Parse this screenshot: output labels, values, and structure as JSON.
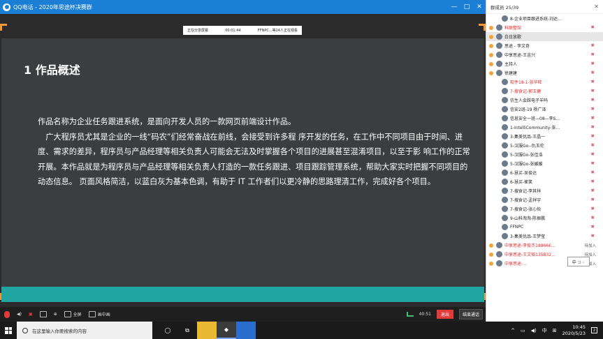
{
  "window": {
    "title": "QQ电话 - 2020年思途杯决赛群",
    "controls": [
      "—",
      "□",
      "✕"
    ]
  },
  "share_status": {
    "label": "正在分享屏幕",
    "timer": "00:01:44",
    "viewers": "FFNPC...等24人正在观看"
  },
  "slide": {
    "title": "1 作品概述",
    "paragraphs": [
      "作品名称为企业任务跟进系统，是面向开发人员的一款网页前端设计作品。",
      "广大程序员尤其是企业的一线“码农”们经常奋战在前线，会接受到许多程 序开发的任务，在工作中不同项目由于时间、进度、需求的差异，程序员与产品经理等相关负责人可能会无法及时掌握各个项目的进展甚至混淆项目，以至于影 响工作的正常开展。本作品就是为程序员与产品经理等相关负责人打造的一款任务跟进、项目跟踪管理系统，帮助大家实时把握不同项目的动态信息。 页面风格简洁，以蓝白灰为基本色调，有助于 IT 工作者们以更冷静的思路理清工作，完成好各个项目。"
    ]
  },
  "toolbar": {
    "fullscreen_label": "全屏",
    "pip_label": "画中画",
    "net_time": "40:51",
    "exit_label": "退出",
    "end_label": "结束通话"
  },
  "panel": {
    "header": "群成员 25/39",
    "members": [
      {
        "name": "8-企业项目跟进系统-刘达...",
        "leader": false,
        "muted": false,
        "status": "",
        "red": false,
        "sel": false
      },
      {
        "name": "科联整馆",
        "leader": true,
        "muted": true,
        "status": "",
        "red": true,
        "sel": false
      },
      {
        "name": "白日放歌",
        "leader": true,
        "muted": false,
        "status": "",
        "red": false,
        "sel": true
      },
      {
        "name": "思途 - 李文奇",
        "leader": true,
        "muted": true,
        "status": "",
        "red": false,
        "sel": false
      },
      {
        "name": "中享思途-王吉兴",
        "leader": true,
        "muted": true,
        "status": "",
        "red": false,
        "sel": false
      },
      {
        "name": "主持人",
        "leader": true,
        "muted": true,
        "status": "",
        "red": false,
        "sel": false
      },
      {
        "name": "徐建建",
        "leader": true,
        "muted": true,
        "status": "",
        "red": false,
        "sel": false
      },
      {
        "name": "软件18-1-张华旺",
        "leader": false,
        "muted": true,
        "status": "",
        "red": true,
        "sel": false
      },
      {
        "name": "7-搜食记-郭玉健",
        "leader": false,
        "muted": true,
        "status": "",
        "red": true,
        "sel": false
      },
      {
        "name": "仿生人会踩电子羊吗",
        "leader": false,
        "muted": true,
        "status": "",
        "red": false,
        "sel": false
      },
      {
        "name": "信安2班-19 杨广泽",
        "leader": false,
        "muted": true,
        "status": "",
        "red": false,
        "sel": false
      },
      {
        "name": "信息安全一班—08—李S...",
        "leader": false,
        "muted": true,
        "status": "",
        "red": false,
        "sel": false
      },
      {
        "name": "1-IntelliCommunity-张...",
        "leader": false,
        "muted": true,
        "status": "",
        "red": false,
        "sel": false
      },
      {
        "name": "3-集美优品-王晶一",
        "leader": false,
        "muted": true,
        "status": "",
        "red": false,
        "sel": false
      },
      {
        "name": "5-汉服Go--仇玉伦",
        "leader": false,
        "muted": true,
        "status": "",
        "red": false,
        "sel": false
      },
      {
        "name": "5-汉服Go-张佳浩",
        "leader": false,
        "muted": true,
        "status": "",
        "red": false,
        "sel": false
      },
      {
        "name": "5-汉服Go-张媛媛",
        "leader": false,
        "muted": true,
        "status": "",
        "red": false,
        "sel": false
      },
      {
        "name": "6-慧买-吴俊达",
        "leader": false,
        "muted": true,
        "status": "",
        "red": false,
        "sel": false
      },
      {
        "name": "6-慧买-崔笑",
        "leader": false,
        "muted": true,
        "status": "",
        "red": false,
        "sel": false
      },
      {
        "name": "7-搜食记-李其祥",
        "leader": false,
        "muted": true,
        "status": "",
        "red": false,
        "sel": false
      },
      {
        "name": "7-搜食记-孟祥宇",
        "leader": false,
        "muted": true,
        "status": "",
        "red": false,
        "sel": false
      },
      {
        "name": "7-搜食记-张心怡",
        "leader": false,
        "muted": true,
        "status": "",
        "red": false,
        "sel": false
      },
      {
        "name": "9-山科淘淘-陈振鹏",
        "leader": false,
        "muted": true,
        "status": "",
        "red": false,
        "sel": false
      },
      {
        "name": "FFNPC",
        "leader": false,
        "muted": true,
        "status": "",
        "red": false,
        "sel": false
      },
      {
        "name": "3-集美优品-王梦莹",
        "leader": false,
        "muted": true,
        "status": "",
        "red": false,
        "sel": false
      },
      {
        "name": "中享思途-李俊杰18866€...",
        "leader": true,
        "muted": false,
        "status": "待加入",
        "red": true,
        "sel": false
      },
      {
        "name": "中享思途-王文韬135832...",
        "leader": true,
        "muted": false,
        "status": "待加入",
        "red": true,
        "sel": false
      },
      {
        "name": "中享思途-...",
        "leader": true,
        "muted": false,
        "status": "待加入",
        "red": true,
        "sel": false
      }
    ]
  },
  "ime_float": "中 ⊃ ◦",
  "taskbar": {
    "search_placeholder": "在这里输入你要搜索的内容",
    "time": "10:45",
    "date": "2020/5/23",
    "ime": "中",
    "notif_count": "2"
  },
  "colors": {
    "title_bar": "#1b7fd6",
    "slide_bg": "#3b3d3f",
    "slide_band": "#21a5a2",
    "share_corner": "#f19a33",
    "exit_red": "#e23b3b"
  }
}
